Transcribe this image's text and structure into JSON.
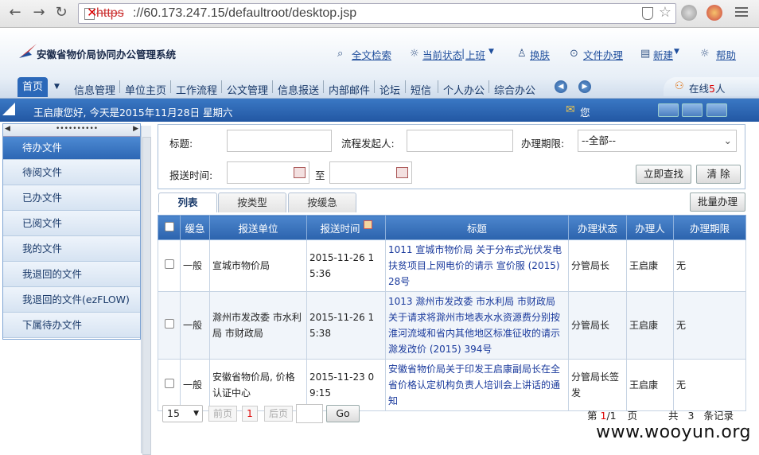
{
  "browser": {
    "url_scheme": "https",
    "url_rest": "://60.173.247.15/defaultroot/desktop.jsp"
  },
  "header": {
    "app_title": "安徽省物价局协同办公管理系统",
    "links": {
      "search": "全文检索",
      "status": "当前状态",
      "status_value": "上班",
      "switch_skin": "换肤",
      "doc_handling": "文件办理",
      "new": "新建",
      "help": "帮助"
    }
  },
  "nav": {
    "tabs": [
      "首页",
      "信息管理",
      "单位主页",
      "工作流程",
      "公文管理",
      "信息报送",
      "内部邮件",
      "论坛",
      "短信",
      "个人办公",
      "综合办公"
    ],
    "online_prefix": "在线",
    "online_count": "5",
    "online_suffix": "人"
  },
  "welcome": {
    "text": "王启康您好, 今天是2015年11月28日 星期六",
    "mail_label": "您"
  },
  "sidebar": {
    "dots": "••••••••••",
    "items": [
      "待办文件",
      "待阅文件",
      "已办文件",
      "已阅文件",
      "我的文件",
      "我退回的文件",
      "我退回的文件(ezFLOW)",
      "下属待办文件"
    ]
  },
  "filter": {
    "title_label": "标题:",
    "initiator_label": "流程发起人:",
    "deadline_label": "办理期限:",
    "deadline_value": "--全部--",
    "submit_time_label": "报送时间:",
    "to_label": "至",
    "search_button": "立即查找",
    "clear_button": "清  除"
  },
  "subtabs": [
    "列表",
    "按类型",
    "按缓急"
  ],
  "batch_button": "批量办理",
  "table": {
    "headers": [
      "缓急",
      "报送单位",
      "报送时间",
      "标题",
      "办理状态",
      "办理人",
      "办理期限"
    ],
    "rows": [
      {
        "urgency": "一般",
        "unit": "宣城市物价局",
        "time": "2015-11-26 15:36",
        "title": "1011 宣城市物价局 关于分布式光伏发电扶贫项目上网电价的请示 宣价服 (2015) 28号",
        "status": "分管局长",
        "handler": "王启康",
        "deadline": "无"
      },
      {
        "urgency": "一般",
        "unit": "滁州市发改委 市水利局 市财政局",
        "time": "2015-11-26 15:38",
        "title": "1013 滁州市发改委 市水利局 市财政局 关于请求将滁州市地表水水资源费分别按淮河流域和省内其他地区标准征收的请示 滁发改价 (2015) 394号",
        "status": "分管局长",
        "handler": "王启康",
        "deadline": "无"
      },
      {
        "urgency": "一般",
        "unit": "安徽省物价局, 价格认证中心",
        "time": "2015-11-23 09:15",
        "title": "安徽省物价局关于印发王启康副局长在全省价格认定机构负责人培训会上讲话的通知",
        "status": "分管局长签发",
        "handler": "王启康",
        "deadline": "无"
      }
    ]
  },
  "pager": {
    "page_size": "15",
    "prev": "前页",
    "current": "1",
    "next": "后页",
    "go": "Go",
    "page_label_pre": "第",
    "page_num": "1",
    "page_total": "/1",
    "page_label_post": "页",
    "total_pre": "共",
    "total_count": "3",
    "total_post": "条记录"
  },
  "watermark": "www.wooyun.org"
}
